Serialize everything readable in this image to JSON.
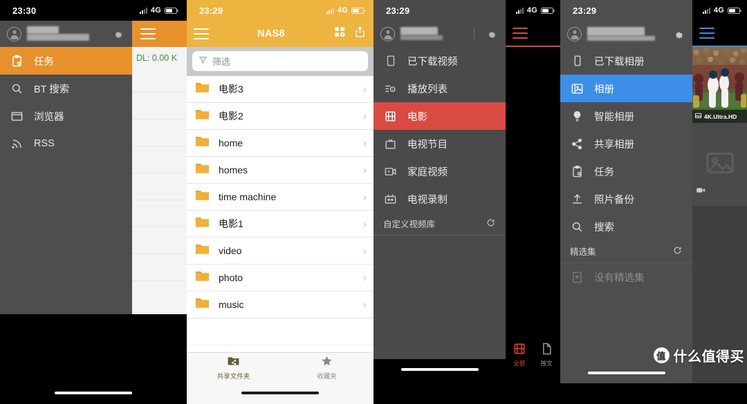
{
  "panels": [
    {
      "id": "downloader",
      "status": {
        "clock": "23:30",
        "network": "4G"
      },
      "drawer": {
        "account_redacted": true,
        "settings_icon": "gear-icon",
        "items": [
          {
            "label": "任务",
            "icon": "task-clipboard-icon",
            "selected": true
          },
          {
            "label": "BT 搜索",
            "icon": "search-icon",
            "selected": false
          },
          {
            "label": "浏览器",
            "icon": "browser-window-icon",
            "selected": false
          },
          {
            "label": "RSS",
            "icon": "rss-icon",
            "selected": false
          }
        ]
      },
      "behind": {
        "download_rate": "DL: 0.00 K",
        "menu_icon": "hamburger-icon"
      }
    },
    {
      "id": "file-browser",
      "status": {
        "clock": "23:29",
        "network": "4G"
      },
      "navbar": {
        "menu_icon": "hamburger-icon",
        "title": "NAS8",
        "grid_icon": "grid-view-icon",
        "share_icon": "share-upload-icon"
      },
      "search": {
        "placeholder": "筛选",
        "icon": "filter-icon",
        "value": ""
      },
      "folders": [
        {
          "name": "电影3"
        },
        {
          "name": "电影2"
        },
        {
          "name": "home"
        },
        {
          "name": "homes"
        },
        {
          "name": "time machine"
        },
        {
          "name": "电影1"
        },
        {
          "name": "video"
        },
        {
          "name": "photo"
        },
        {
          "name": "music"
        }
      ],
      "tabs": [
        {
          "label": "共享文件夹",
          "icon": "shared-folder-icon",
          "active": true
        },
        {
          "label": "收藏夹",
          "icon": "star-icon",
          "active": false
        }
      ]
    },
    {
      "id": "video-station",
      "status": {
        "clock": "23:29",
        "network": "4G"
      },
      "drawer": {
        "account_redacted": true,
        "settings_icon": "gear-icon",
        "items": [
          {
            "label": "已下载视频",
            "icon": "device-icon",
            "selected": false
          },
          {
            "label": "播放列表",
            "icon": "playlist-icon",
            "selected": false
          },
          {
            "label": "电影",
            "icon": "film-icon",
            "selected": true
          },
          {
            "label": "电视节目",
            "icon": "tv-icon",
            "selected": false
          },
          {
            "label": "家庭视频",
            "icon": "home-video-icon",
            "selected": false
          },
          {
            "label": "电视录制",
            "icon": "tv-record-icon",
            "selected": false
          }
        ],
        "section": {
          "label": "自定义视频库",
          "refresh_icon": "refresh-icon"
        }
      },
      "right": {
        "menu_icon": "hamburger-icon",
        "tabs": [
          {
            "label": "全部",
            "icon": "film-icon",
            "active": true
          },
          {
            "label": "按文",
            "icon": "file-icon",
            "active": false
          }
        ]
      }
    },
    {
      "id": "photo-station",
      "status": {
        "clock": "23:29",
        "network": "4G"
      },
      "drawer": {
        "account_redacted": true,
        "settings_icon": "gear-icon",
        "items": [
          {
            "label": "已下载相册",
            "icon": "device-icon",
            "selected": false
          },
          {
            "label": "相册",
            "icon": "photo-album-icon",
            "selected": true
          },
          {
            "label": "智能相册",
            "icon": "lightbulb-icon",
            "selected": false
          },
          {
            "label": "共享相册",
            "icon": "share-node-icon",
            "selected": false
          },
          {
            "label": "任务",
            "icon": "task-clipboard-icon",
            "selected": false
          },
          {
            "label": "照片备份",
            "icon": "upload-icon",
            "selected": false
          },
          {
            "label": "搜索",
            "icon": "search-icon",
            "selected": false
          }
        ],
        "section": {
          "label": "精选集",
          "refresh_icon": "refresh-icon"
        },
        "empty_state": {
          "label": "没有精选集",
          "icon": "bookmark-icon"
        }
      },
      "right": {
        "menu_icon": "hamburger-icon",
        "thumbnails": [
          {
            "caption": "4K.Ultra.HD",
            "icon": "image-icon",
            "type": "photo"
          },
          {
            "caption": "",
            "icon": "video-icon",
            "type": "placeholder"
          }
        ]
      }
    }
  ],
  "watermark": {
    "logo": "值",
    "text": "什么值得买"
  },
  "colors": {
    "orange": "#e8912d",
    "orange_navbar": "#eeb440",
    "red": "#d94b42",
    "blue": "#3c8ee8",
    "drawer_bg": "#4e4e4e",
    "green": "#3a8f36"
  }
}
